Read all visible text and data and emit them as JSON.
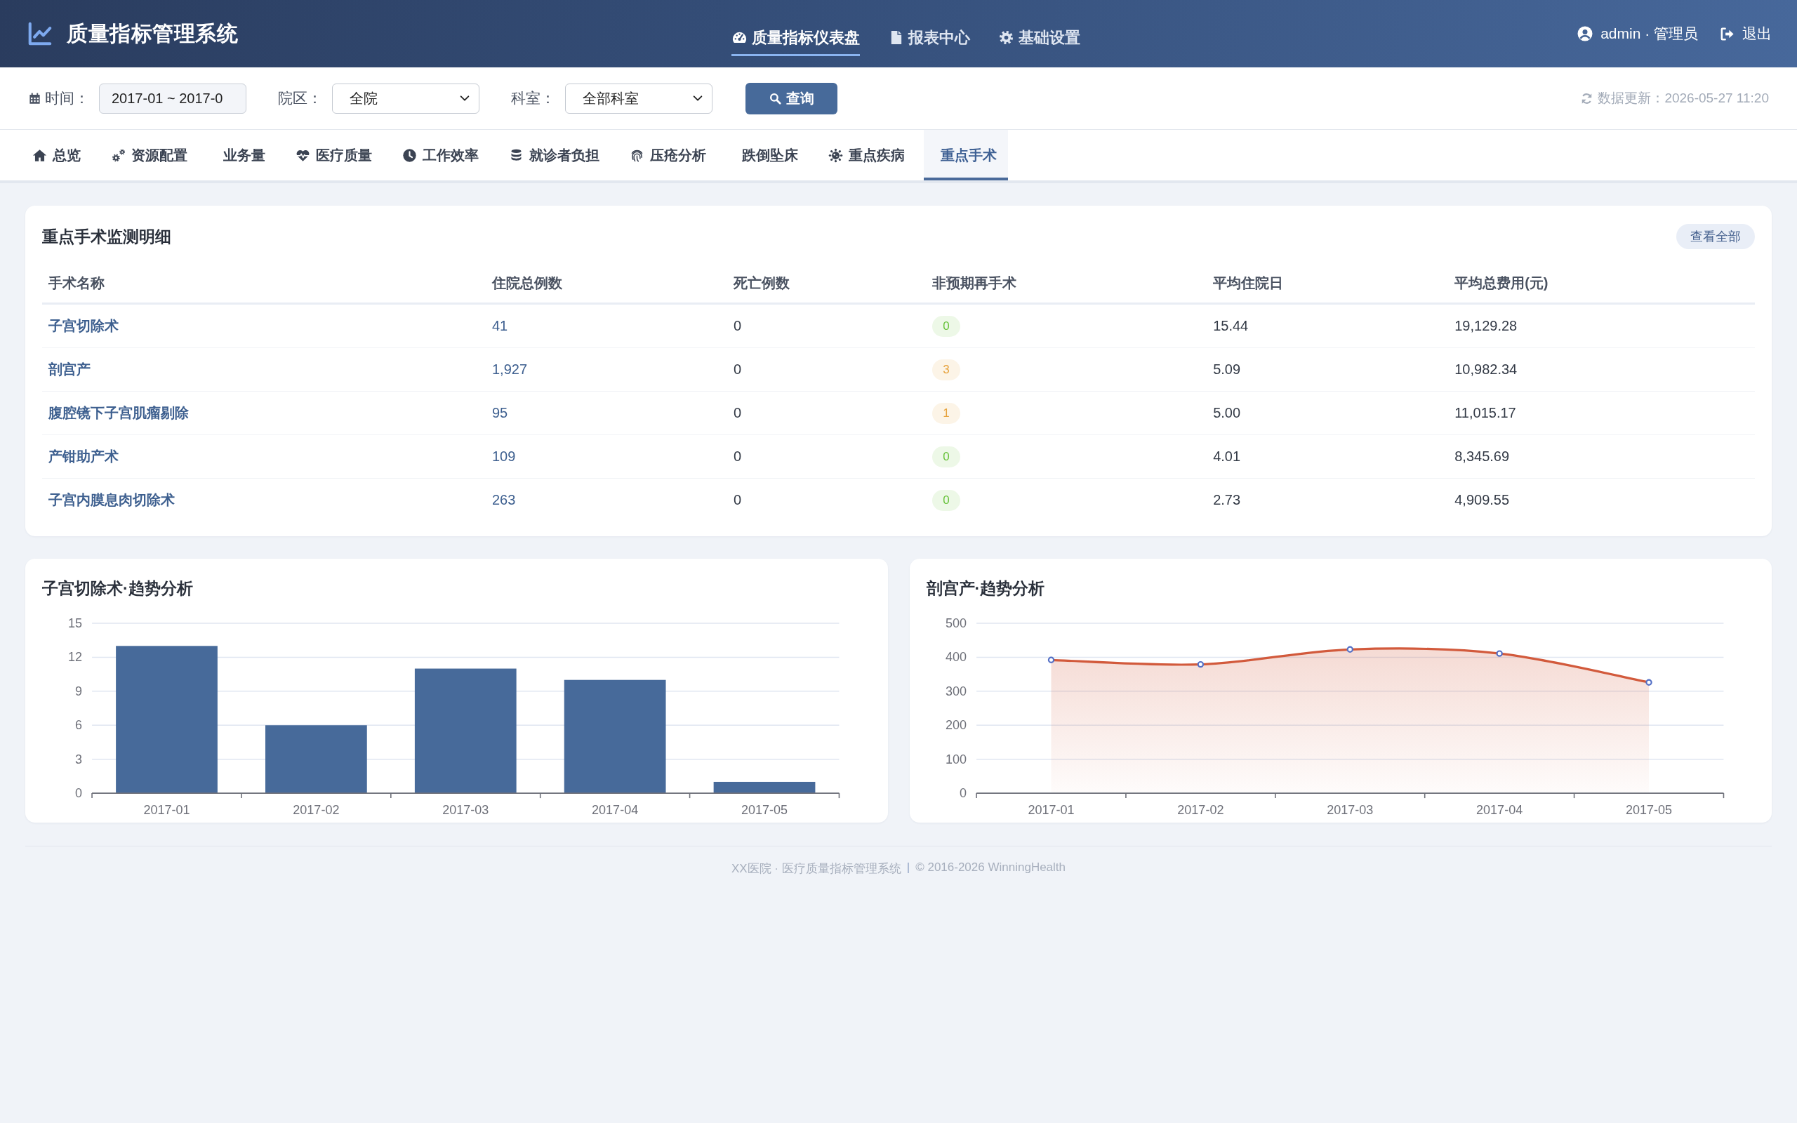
{
  "header": {
    "title": "质量指标管理系统",
    "nav": [
      {
        "label": "质量指标仪表盘",
        "selected": true
      },
      {
        "label": "报表中心",
        "selected": false
      },
      {
        "label": "基础设置",
        "selected": false
      }
    ],
    "user": "admin · 管理员",
    "logout": "退出"
  },
  "filters": {
    "time": {
      "label": "时间：",
      "value": "2017-01 ~ 2017-0"
    },
    "campus": {
      "label": "院区：",
      "value": "全院"
    },
    "department": {
      "label": "科室：",
      "value": "全部科室"
    },
    "query_button": "查询",
    "updated": "数据更新：2026-05-27 11:20"
  },
  "tabs": [
    {
      "label": "总览",
      "selected": false
    },
    {
      "label": "资源配置",
      "selected": false
    },
    {
      "label": "业务量",
      "selected": false
    },
    {
      "label": "医疗质量",
      "selected": false
    },
    {
      "label": "工作效率",
      "selected": false
    },
    {
      "label": "就诊者负担",
      "selected": false
    },
    {
      "label": "压疮分析",
      "selected": false
    },
    {
      "label": "跌倒坠床",
      "selected": false
    },
    {
      "label": "重点疾病",
      "selected": false
    },
    {
      "label": "重点手术",
      "selected": true
    }
  ],
  "surgery_table": {
    "title": "重点手术监测明细",
    "view_all": "查看全部",
    "columns": [
      "手术名称",
      "住院总例数",
      "死亡例数",
      "非预期再手术",
      "平均住院日",
      "平均总费用(元)"
    ],
    "rows": [
      {
        "name": "子宫切除术",
        "admissions": "41",
        "deaths": "0",
        "reoperations": {
          "value": "0",
          "color": "#67c23a"
        },
        "avg_stay": "15.44",
        "avg_cost": "19,129.28"
      },
      {
        "name": "剖宫产",
        "admissions": "1,927",
        "deaths": "0",
        "reoperations": {
          "value": "3",
          "color": "#e6a23c"
        },
        "avg_stay": "5.09",
        "avg_cost": "10,982.34"
      },
      {
        "name": "腹腔镜下子宫肌瘤剔除",
        "admissions": "95",
        "deaths": "0",
        "reoperations": {
          "value": "1",
          "color": "#e6a23c"
        },
        "avg_stay": "5.00",
        "avg_cost": "11,015.17"
      },
      {
        "name": "产钳助产术",
        "admissions": "109",
        "deaths": "0",
        "reoperations": {
          "value": "0",
          "color": "#67c23a"
        },
        "avg_stay": "4.01",
        "avg_cost": "8,345.69"
      },
      {
        "name": "子宫内膜息肉切除术",
        "admissions": "263",
        "deaths": "0",
        "reoperations": {
          "value": "0",
          "color": "#67c23a"
        },
        "avg_stay": "2.73",
        "avg_cost": "4,909.55"
      }
    ]
  },
  "trend_charts": [
    {
      "chart_data": {
        "type": "bar",
        "title": "子宫切除术·趋势分析",
        "categories": [
          "2017-01",
          "2017-02",
          "2017-03",
          "2017-04",
          "2017-05"
        ],
        "values": [
          13,
          6,
          11,
          10,
          1
        ],
        "color": "#476a9a",
        "ylim": [
          0,
          15
        ],
        "yticks": [
          0,
          3,
          6,
          9,
          12,
          15
        ],
        "grid": true
      }
    },
    {
      "chart_data": {
        "type": "area",
        "title": "剖宫产·趋势分析",
        "categories": [
          "2017-01",
          "2017-02",
          "2017-03",
          "2017-04",
          "2017-05"
        ],
        "values": [
          392,
          379,
          423,
          411,
          326
        ],
        "color": "#d25a3c",
        "ylim": [
          0,
          500
        ],
        "yticks": [
          0,
          100,
          200,
          300,
          400,
          500
        ],
        "grid": true,
        "marker": "circle"
      }
    }
  ],
  "footer": {
    "organization": "XX医院 · 医疗质量指标管理系统",
    "separator": "|",
    "copyright": "© 2016-2026 WinningHealth"
  }
}
